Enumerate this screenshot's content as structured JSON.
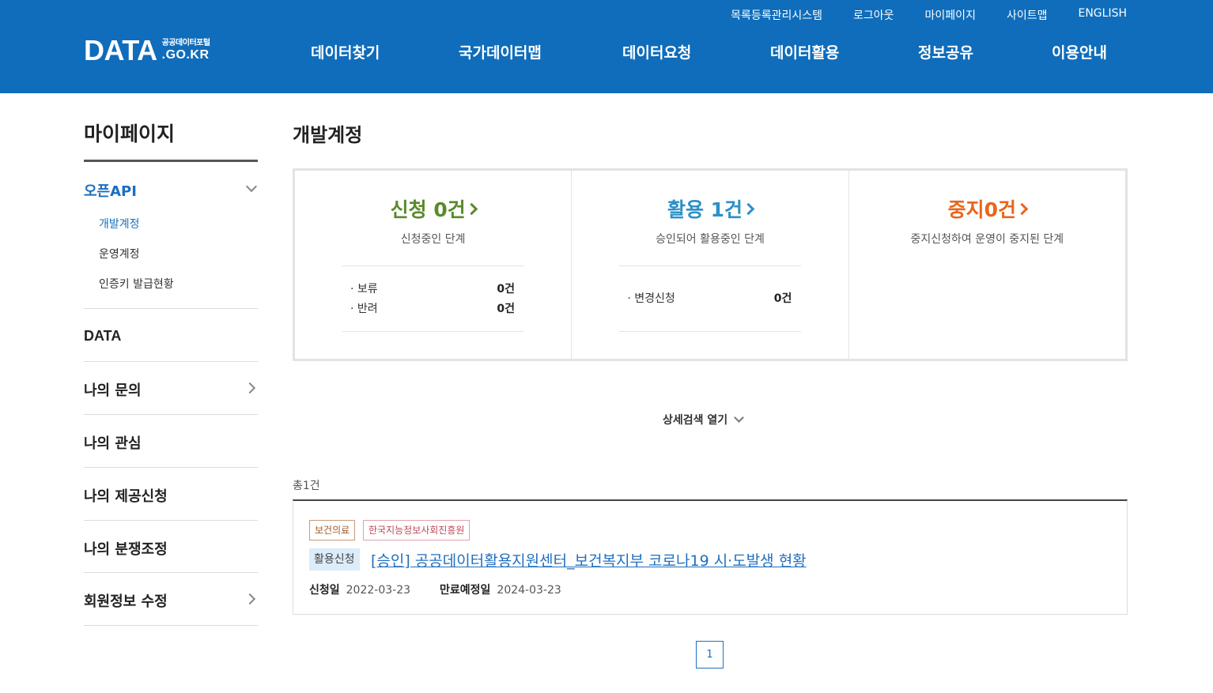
{
  "header": {
    "util_links": [
      "목록등록관리시스템",
      "로그아웃",
      "마이페이지",
      "사이트맵",
      "ENGLISH"
    ],
    "logo_main": "DATA",
    "logo_kr": "공공데이터포털",
    "logo_domain": ".GO.KR",
    "nav": [
      "데이터찾기",
      "국가데이터맵",
      "데이터요청",
      "데이터활용",
      "정보공유",
      "이용안내"
    ]
  },
  "sidebar": {
    "title": "마이페이지",
    "open_api": "오픈API",
    "sub_items": [
      "개발계정",
      "운영계정",
      "인증키 발급현황"
    ],
    "data_item": "DATA",
    "items": [
      "나의 문의",
      "나의 관심",
      "나의 제공신청",
      "나의 분쟁조정",
      "회원정보 수정"
    ]
  },
  "main": {
    "title": "개발계정",
    "status": {
      "apply": {
        "label": "신청 0건",
        "desc": "신청중인 단계",
        "rows": [
          {
            "label": "· 보류",
            "count": "0건"
          },
          {
            "label": "· 반려",
            "count": "0건"
          }
        ]
      },
      "use": {
        "label": "활용 1건",
        "desc": "승인되어 활용중인 단계",
        "rows": [
          {
            "label": "· 변경신청",
            "count": "0건"
          }
        ]
      },
      "stop": {
        "label": "중지0건",
        "desc": "중지신청하여 운영이 중지된 단계"
      }
    },
    "detail_search": "상세검색 열기",
    "total": "총1건",
    "result": {
      "tag1": "보건의료",
      "tag2": "한국지능정보사회진흥원",
      "badge": "활용신청",
      "title": "[승인] 공공데이터활용지원센터_보건복지부 코로나19 시·도발생 현황",
      "apply_label": "신청일",
      "apply_date": "2022-03-23",
      "expire_label": "만료예정일",
      "expire_date": "2024-03-23"
    },
    "page": "1"
  },
  "colors": {
    "header_bg": "#0f6dbb",
    "apply": "#5a8a2a",
    "use": "#2b90c8",
    "stop": "#e8661a",
    "link": "#1f6fc0"
  }
}
